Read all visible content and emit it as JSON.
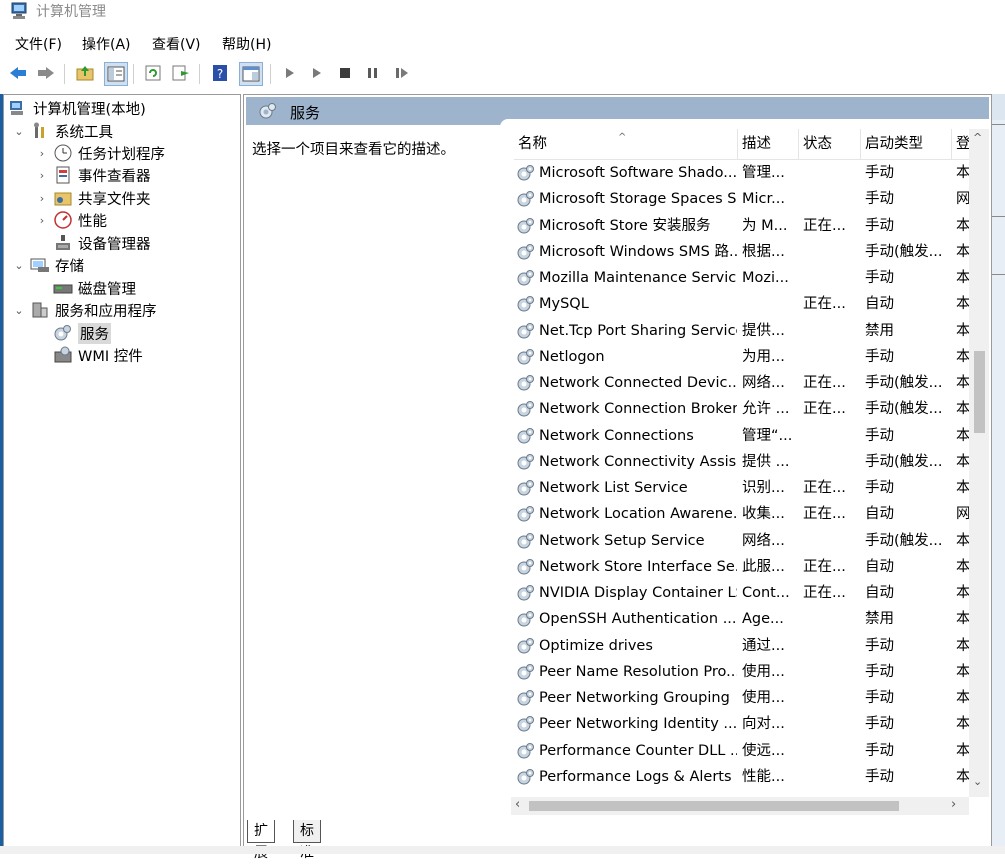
{
  "window": {
    "title": "计算机管理"
  },
  "menu": [
    "文件(F)",
    "操作(A)",
    "查看(V)",
    "帮助(H)"
  ],
  "toolbar": {
    "icons": [
      "back-icon",
      "forward-icon",
      "up-folder-icon",
      "show-hide-tree-icon",
      "refresh-icon",
      "export-list-icon",
      "help-icon",
      "properties-icon",
      "start-service-icon",
      "start-service-alt-icon",
      "stop-service-icon",
      "pause-service-icon",
      "restart-service-icon"
    ]
  },
  "tree": {
    "root": "计算机管理(本地)",
    "system_tools": "系统工具",
    "task_scheduler": "任务计划程序",
    "event_viewer": "事件查看器",
    "shared_folders": "共享文件夹",
    "performance": "性能",
    "device_manager": "设备管理器",
    "storage": "存储",
    "disk_management": "磁盘管理",
    "services_apps": "服务和应用程序",
    "services": "服务",
    "wmi": "WMI 控件"
  },
  "panel": {
    "title": "服务",
    "description_prompt": "选择一个项目来查看它的描述。"
  },
  "columns": {
    "name": "名称",
    "desc": "描述",
    "status": "状态",
    "startup": "启动类型",
    "logon": "登"
  },
  "services": [
    {
      "name": "Microsoft Software Shado...",
      "desc": "管理...",
      "status": "",
      "startup": "手动",
      "logon": "本"
    },
    {
      "name": "Microsoft Storage Spaces S...",
      "desc": "Micr...",
      "status": "",
      "startup": "手动",
      "logon": "网"
    },
    {
      "name": "Microsoft Store 安装服务",
      "desc": "为 M...",
      "status": "正在...",
      "startup": "手动",
      "logon": "本"
    },
    {
      "name": "Microsoft Windows SMS 路...",
      "desc": "根据...",
      "status": "",
      "startup": "手动(触发...",
      "logon": "本"
    },
    {
      "name": "Mozilla Maintenance Service",
      "desc": "Mozi...",
      "status": "",
      "startup": "手动",
      "logon": "本"
    },
    {
      "name": "MySQL",
      "desc": "",
      "status": "正在...",
      "startup": "自动",
      "logon": "本"
    },
    {
      "name": "Net.Tcp Port Sharing Service",
      "desc": "提供...",
      "status": "",
      "startup": "禁用",
      "logon": "本"
    },
    {
      "name": "Netlogon",
      "desc": "为用...",
      "status": "",
      "startup": "手动",
      "logon": "本"
    },
    {
      "name": "Network Connected Devic...",
      "desc": "网络...",
      "status": "正在...",
      "startup": "手动(触发...",
      "logon": "本"
    },
    {
      "name": "Network Connection Broker",
      "desc": "允许 ...",
      "status": "正在...",
      "startup": "手动(触发...",
      "logon": "本"
    },
    {
      "name": "Network Connections",
      "desc": "管理“...",
      "status": "",
      "startup": "手动",
      "logon": "本"
    },
    {
      "name": "Network Connectivity Assis...",
      "desc": "提供 ...",
      "status": "",
      "startup": "手动(触发...",
      "logon": "本"
    },
    {
      "name": "Network List Service",
      "desc": "识别...",
      "status": "正在...",
      "startup": "手动",
      "logon": "本"
    },
    {
      "name": "Network Location Awarene...",
      "desc": "收集...",
      "status": "正在...",
      "startup": "自动",
      "logon": "网"
    },
    {
      "name": "Network Setup Service",
      "desc": "网络...",
      "status": "",
      "startup": "手动(触发...",
      "logon": "本"
    },
    {
      "name": "Network Store Interface Se...",
      "desc": "此服...",
      "status": "正在...",
      "startup": "自动",
      "logon": "本"
    },
    {
      "name": "NVIDIA Display Container LS",
      "desc": "Cont...",
      "status": "正在...",
      "startup": "自动",
      "logon": "本"
    },
    {
      "name": "OpenSSH Authentication ...",
      "desc": "Age...",
      "status": "",
      "startup": "禁用",
      "logon": "本"
    },
    {
      "name": "Optimize drives",
      "desc": "通过...",
      "status": "",
      "startup": "手动",
      "logon": "本"
    },
    {
      "name": "Peer Name Resolution Pro...",
      "desc": "使用...",
      "status": "",
      "startup": "手动",
      "logon": "本"
    },
    {
      "name": "Peer Networking Grouping",
      "desc": "使用...",
      "status": "",
      "startup": "手动",
      "logon": "本"
    },
    {
      "name": "Peer Networking Identity ...",
      "desc": "向对...",
      "status": "",
      "startup": "手动",
      "logon": "本"
    },
    {
      "name": "Performance Counter DLL ...",
      "desc": "使远...",
      "status": "",
      "startup": "手动",
      "logon": "本"
    },
    {
      "name": "Performance Logs & Alerts",
      "desc": "性能...",
      "status": "",
      "startup": "手动",
      "logon": "本"
    }
  ],
  "bottom_tabs": [
    "扩展",
    "标准"
  ]
}
